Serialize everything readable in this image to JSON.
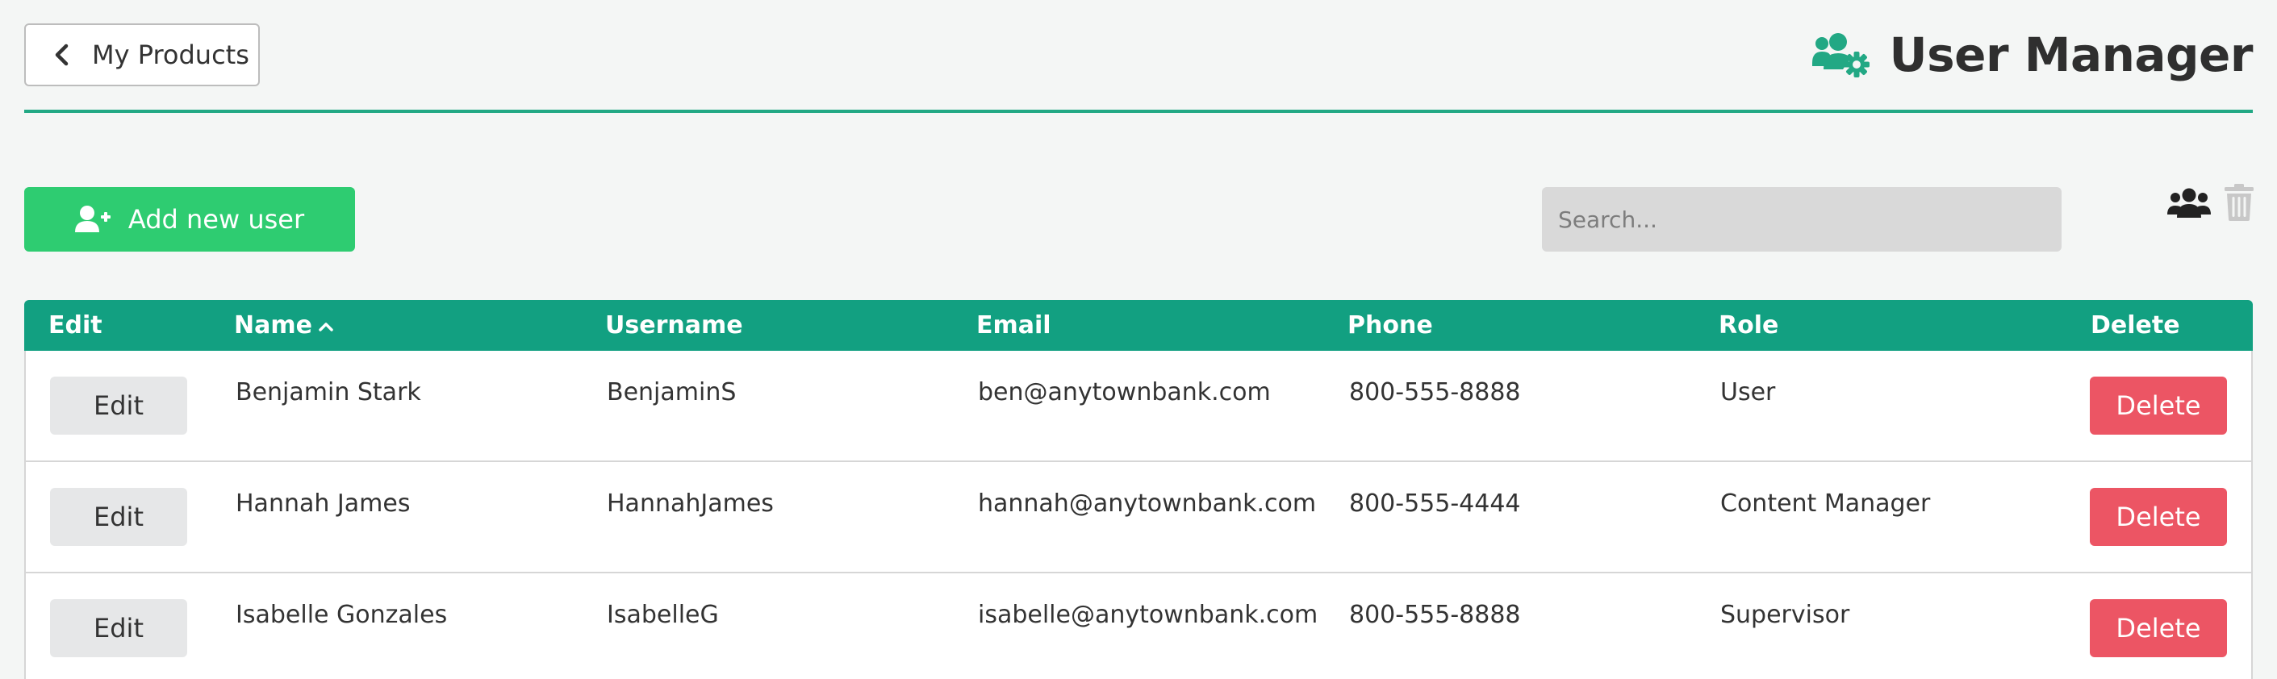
{
  "header": {
    "back_label": "My Products",
    "title": "User Manager",
    "accent_color": "#22a884"
  },
  "toolbar": {
    "add_label": "Add new user",
    "search_placeholder": "Search...",
    "add_color": "#2ecc71"
  },
  "table": {
    "columns": [
      "Edit",
      "Name",
      "Username",
      "Email",
      "Phone",
      "Role",
      "Delete"
    ],
    "sorted_column": "Name",
    "sort_direction": "ascending",
    "header_color": "#12a081",
    "rows": [
      {
        "edit_label": "Edit",
        "name": "Benjamin Stark",
        "username": "BenjaminS",
        "email": "ben@anytownbank.com",
        "phone": "800-555-8888",
        "role": "User",
        "delete_label": "Delete"
      },
      {
        "edit_label": "Edit",
        "name": "Hannah James",
        "username": "HannahJames",
        "email": "hannah@anytownbank.com",
        "phone": "800-555-4444",
        "role": "Content Manager",
        "delete_label": "Delete"
      },
      {
        "edit_label": "Edit",
        "name": "Isabelle Gonzales",
        "username": "IsabelleG",
        "email": "isabelle@anytownbank.com",
        "phone": "800-555-8888",
        "role": "Supervisor",
        "delete_label": "Delete"
      }
    ]
  },
  "icons": {
    "back": "chevron-left-icon",
    "title": "users-cog-icon",
    "add_user": "user-plus-icon",
    "view_users": "users-icon",
    "view_deleted": "trash-icon",
    "sort": "caret-up-icon"
  },
  "colors": {
    "delete": "#ec5564",
    "edit_bg": "#e6e7e8",
    "search_bg": "#d9d9d9"
  }
}
